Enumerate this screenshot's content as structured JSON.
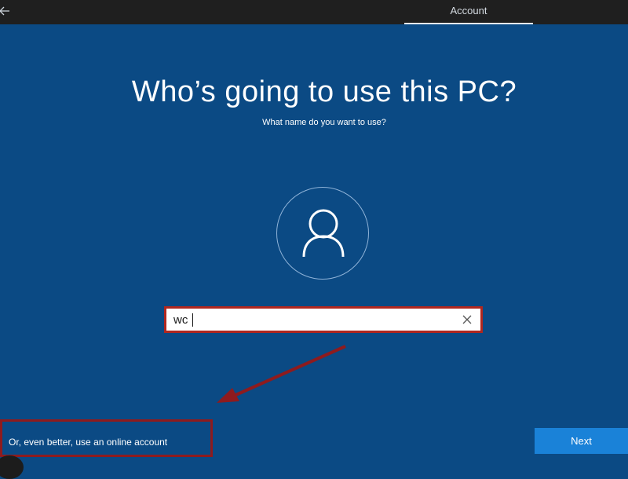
{
  "header": {
    "tab_label": "Account",
    "back_icon": "back-arrow-icon"
  },
  "main": {
    "title": "Who’s going to use this PC?",
    "subtitle": "What name do you want to use?",
    "avatar_icon": "user-icon",
    "name_input": {
      "value": "wc",
      "clear_icon": "close-icon"
    }
  },
  "footer": {
    "online_account_link": "Or, even better, use an online account",
    "next_label": "Next"
  },
  "colors": {
    "background": "#0b4a84",
    "topbar": "#1f1f1f",
    "highlight_box": "#b0271f",
    "arrow": "#8e1b1e",
    "next_button": "#1a82d8"
  }
}
